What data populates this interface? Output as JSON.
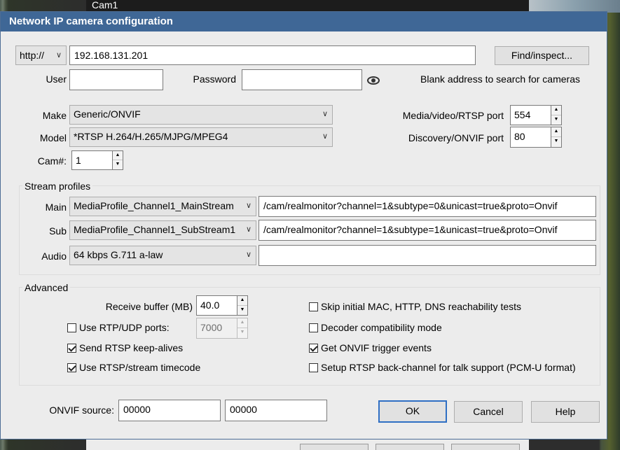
{
  "background": {
    "window_title": "Cam1"
  },
  "dialog": {
    "title": "Network IP camera configuration"
  },
  "address": {
    "protocol": "http://",
    "host": "192.168.131.201",
    "find_button": "Find/inspect..."
  },
  "credentials": {
    "user_label": "User",
    "user_value": "",
    "password_label": "Password",
    "password_value": "",
    "hint": "Blank address to search for cameras"
  },
  "device": {
    "make_label": "Make",
    "make_value": "Generic/ONVIF",
    "model_label": "Model",
    "model_value": "*RTSP H.264/H.265/MJPG/MPEG4",
    "cam_label": "Cam#:",
    "cam_value": "1",
    "media_port_label": "Media/video/RTSP port",
    "media_port_value": "554",
    "discovery_port_label": "Discovery/ONVIF port",
    "discovery_port_value": "80"
  },
  "stream_profiles": {
    "title": "Stream profiles",
    "rows": [
      {
        "label": "Main",
        "profile": "MediaProfile_Channel1_MainStream",
        "path": "/cam/realmonitor?channel=1&subtype=0&unicast=true&proto=Onvif"
      },
      {
        "label": "Sub",
        "profile": "MediaProfile_Channel1_SubStream1",
        "path": "/cam/realmonitor?channel=1&subtype=1&unicast=true&proto=Onvif"
      },
      {
        "label": "Audio",
        "profile": "64 kbps G.711 a-law",
        "path": ""
      }
    ]
  },
  "advanced": {
    "title": "Advanced",
    "receive_buffer_label": "Receive buffer (MB)",
    "receive_buffer_value": "40.0",
    "rtp_udp_label": "Use RTP/UDP ports:",
    "rtp_udp_checked": false,
    "rtp_udp_value": "7000",
    "keepalive_label": "Send RTSP keep-alives",
    "keepalive_checked": true,
    "timecode_label": "Use RTSP/stream timecode",
    "timecode_checked": true,
    "skip_label": "Skip initial MAC, HTTP, DNS reachability tests",
    "skip_checked": false,
    "decoder_label": "Decoder compatibility mode",
    "decoder_checked": false,
    "onvif_events_label": "Get ONVIF trigger events",
    "onvif_events_checked": true,
    "backchannel_label": "Setup RTSP back-channel for talk support (PCM-U format)",
    "backchannel_checked": false
  },
  "footer": {
    "onvif_source_label": "ONVIF source:",
    "source_1": "00000",
    "source_2": "00000",
    "ok": "OK",
    "cancel": "Cancel",
    "help": "Help"
  },
  "colors": {
    "titlebar": "#3f6796",
    "dialog_bg": "#ececec",
    "default_button_border": "#2f6fc4"
  }
}
